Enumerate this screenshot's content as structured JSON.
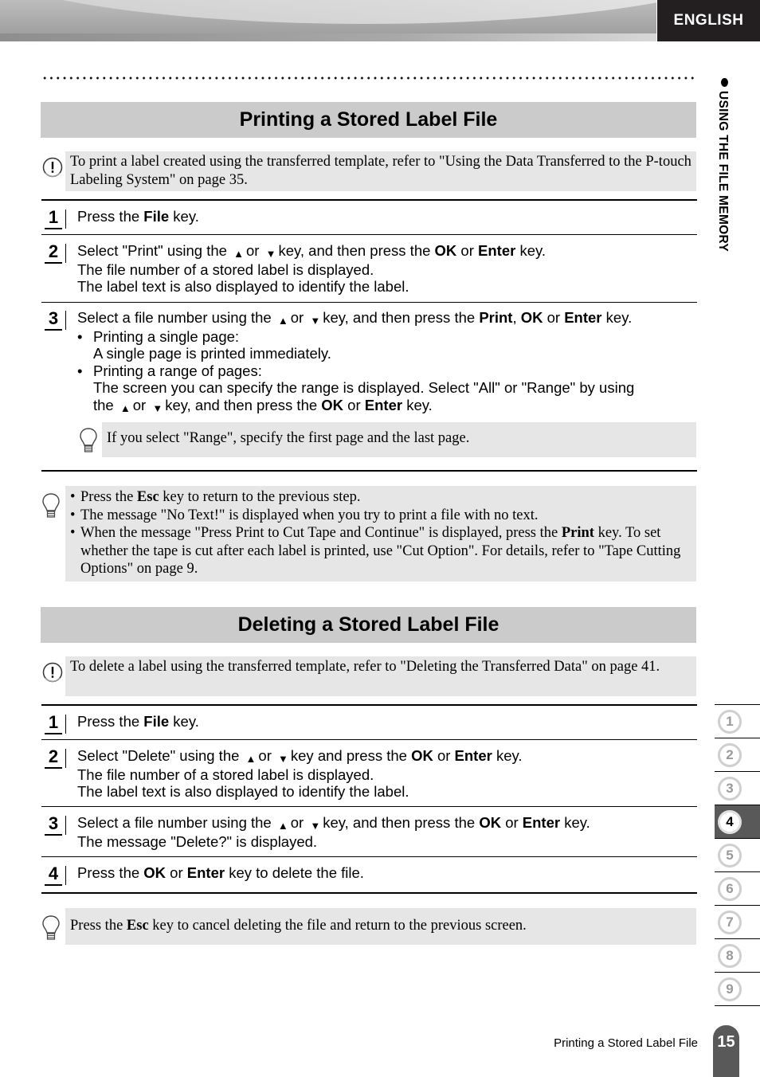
{
  "header": {
    "language_tab": "ENGLISH"
  },
  "side_chapter_label": "USING THE FILE MEMORY",
  "sections": [
    {
      "title": "Printing a Stored Label File",
      "caution": "To print a label created using the transferred template, refer to \"Using the Data Transferred to the P-touch Labeling System\" on page 35.",
      "steps": [
        {
          "num": "1",
          "pre": "Press the ",
          "bold1": "File",
          "post": " key."
        },
        {
          "num": "2",
          "pre": "Select \"Print\" using the",
          "or": "or",
          "mid": "key, and then press the ",
          "bold1": "OK",
          "sep": " or ",
          "bold2": "Enter",
          "post": " key.",
          "lines": [
            "The file number of a stored label is displayed.",
            "The label text is also displayed to identify the label."
          ]
        },
        {
          "num": "3",
          "pre": "Select a file number using the",
          "or": "or",
          "mid": "key, and then press the ",
          "bold1": "Print",
          "sep1": ", ",
          "bold2": "OK",
          "sep2": " or ",
          "bold3": "Enter",
          "post": " key.",
          "bullets": [
            {
              "head": "Printing a single page:",
              "body": "A single page is printed immediately."
            },
            {
              "head": "Printing a range of pages:",
              "body": "The screen you can specify the range is displayed. Select  \"All\" or \"Range\" by using",
              "body2_pre": "the",
              "body2_or": "or",
              "body2_mid": "key, and then press the ",
              "body2_b1": "OK",
              "body2_sep": " or ",
              "body2_b2": "Enter",
              "body2_post": " key."
            }
          ],
          "hint": "If you select \"Range\", specify the first page and the last page."
        }
      ],
      "hints": [
        {
          "pre": "Press the ",
          "bold": "Esc",
          "post": " key to return to the previous step."
        },
        {
          "text": "The message \"No Text!\" is displayed when you try to print a file with no text."
        },
        {
          "pre": "When the message \"Press Print to Cut Tape and Continue\" is displayed, press the ",
          "bold": "Print",
          "post": " key. To set whether the tape is cut after each label is printed, use \"Cut Option\". For details, refer to \"Tape Cutting Options\" on page 9."
        }
      ]
    },
    {
      "title": "Deleting a Stored Label File",
      "caution": "To delete a label using the transferred template, refer to \"Deleting the Transferred Data\" on page 41.",
      "steps": [
        {
          "num": "1",
          "pre": "Press the ",
          "bold1": "File",
          "post": " key."
        },
        {
          "num": "2",
          "pre": "Select \"Delete\" using the",
          "or": "or",
          "mid": "key and press the ",
          "bold1": "OK",
          "sep": " or ",
          "bold2": "Enter",
          "post": " key.",
          "lines": [
            "The file number of a stored label is displayed.",
            "The label text is also displayed to identify the label."
          ]
        },
        {
          "num": "3",
          "pre": "Select a file number using the",
          "or": "or",
          "mid": "key, and then press the ",
          "bold1": "OK",
          "sep": " or ",
          "bold2": "Enter",
          "post": " key.",
          "lines": [
            "The message \"Delete?\" is displayed."
          ]
        },
        {
          "num": "4",
          "pre": "Press the ",
          "bold1": "OK",
          "sep": " or ",
          "bold2": "Enter",
          "post": " key to delete the file."
        }
      ],
      "hint": {
        "pre": "Press the ",
        "bold": "Esc",
        "post": " key to cancel deleting the file and return to the previous screen."
      }
    }
  ],
  "icons": {
    "up": "▲",
    "down": "▼",
    "bullet": "•"
  },
  "chapter_tabs": [
    {
      "label": "1",
      "active": false
    },
    {
      "label": "2",
      "active": false
    },
    {
      "label": "3",
      "active": false
    },
    {
      "label": "4",
      "active": true
    },
    {
      "label": "5",
      "active": false
    },
    {
      "label": "6",
      "active": false
    },
    {
      "label": "7",
      "active": false
    },
    {
      "label": "8",
      "active": false
    },
    {
      "label": "9",
      "active": false
    }
  ],
  "footer": {
    "section_title": "Printing a Stored Label File",
    "page_number": "15"
  }
}
